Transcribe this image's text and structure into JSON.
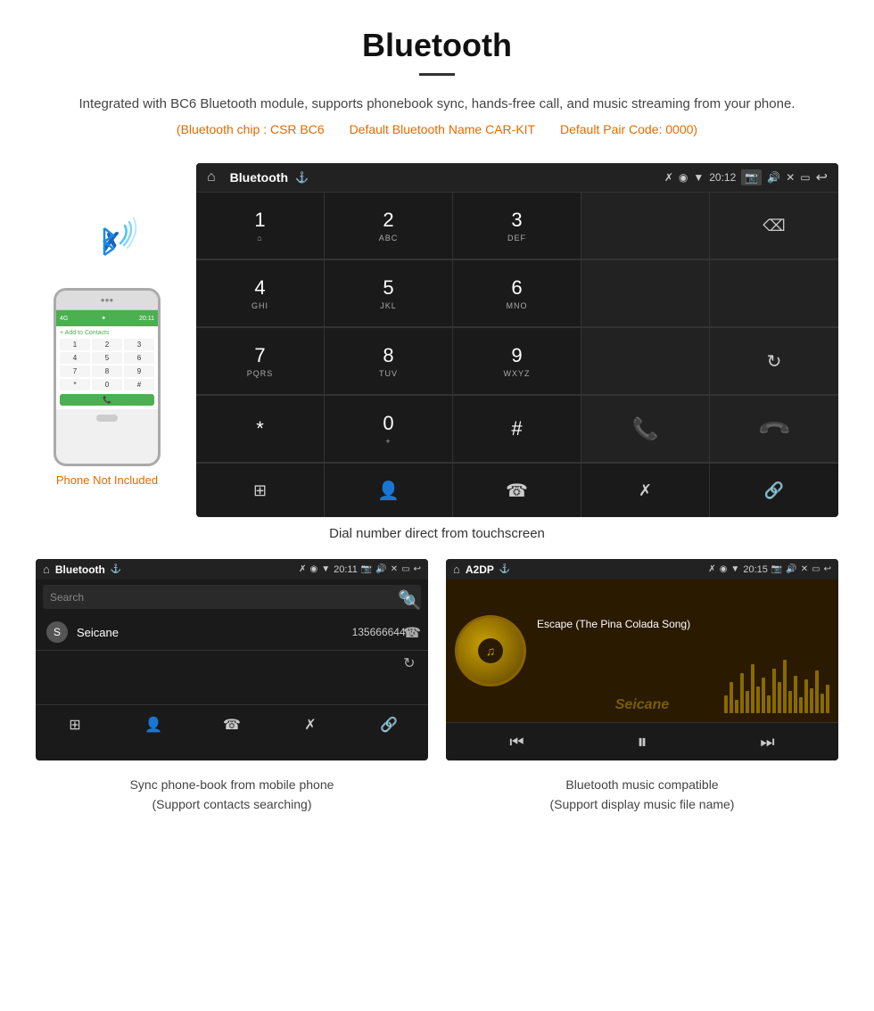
{
  "page": {
    "title": "Bluetooth",
    "description": "Integrated with BC6 Bluetooth module, supports phonebook sync, hands-free call, and music streaming from your phone.",
    "specs": [
      "(Bluetooth chip : CSR BC6",
      "Default Bluetooth Name CAR-KIT",
      "Default Pair Code: 0000)"
    ],
    "main_caption": "Dial number direct from touchscreen",
    "phone_not_included": "Phone Not Included"
  },
  "dialpad_screen": {
    "status_title": "Bluetooth",
    "status_time": "20:12",
    "keys": [
      {
        "num": "1",
        "sub": "⌂",
        "row": 1
      },
      {
        "num": "2",
        "sub": "ABC",
        "row": 1
      },
      {
        "num": "3",
        "sub": "DEF",
        "row": 1
      },
      {
        "num": "4",
        "sub": "GHI",
        "row": 2
      },
      {
        "num": "5",
        "sub": "JKL",
        "row": 2
      },
      {
        "num": "6",
        "sub": "MNO",
        "row": 2
      },
      {
        "num": "7",
        "sub": "PQRS",
        "row": 3
      },
      {
        "num": "8",
        "sub": "TUV",
        "row": 3
      },
      {
        "num": "9",
        "sub": "WXYZ",
        "row": 3
      },
      {
        "num": "*",
        "sub": "",
        "row": 4
      },
      {
        "num": "0",
        "sub": "+",
        "row": 4
      },
      {
        "num": "#",
        "sub": "",
        "row": 4
      }
    ]
  },
  "phonebook_screen": {
    "status_title": "Bluetooth",
    "status_time": "20:11",
    "search_placeholder": "Search",
    "contact": {
      "letter": "S",
      "name": "Seicane",
      "number": "13566664466"
    }
  },
  "music_screen": {
    "status_title": "A2DP",
    "status_time": "20:15",
    "song_title": "Escape (The Pina Colada Song)"
  },
  "bottom_captions": {
    "left": "Sync phone-book from mobile phone\n(Support contacts searching)",
    "right": "Bluetooth music compatible\n(Support display music file name)"
  },
  "colors": {
    "orange_accent": "#e06c00",
    "green": "#4CAF50",
    "red": "#e53935",
    "gold": "#c8a000",
    "blue_bt": "#1565C0"
  }
}
